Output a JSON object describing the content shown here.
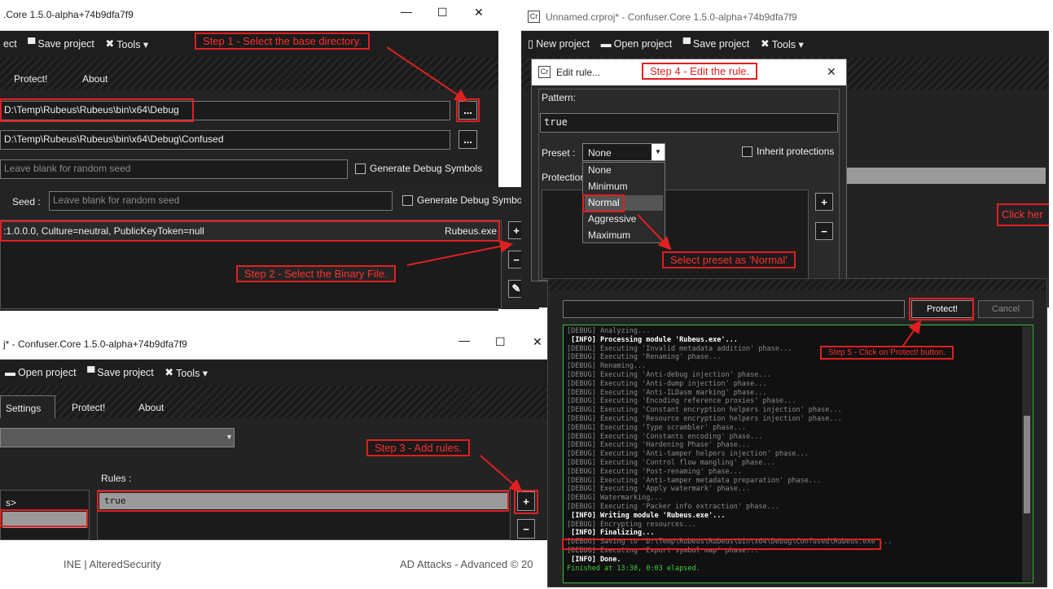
{
  "win1": {
    "title": ".Core 1.5.0-alpha+74b9dfa7f9",
    "menu": {
      "project": "ect",
      "save": "Save project",
      "tools": "Tools ▾"
    },
    "tabs": [
      "Protect!",
      "About"
    ],
    "base_dir": "D:\\Temp\\Rubeus\\Rubeus\\bin\\x64\\Debug",
    "output_dir": "D:\\Temp\\Rubeus\\Rubeus\\bin\\x64\\Debug\\Confused",
    "seed_placeholder": "Leave blank for random seed",
    "gen_debug": "Generate Debug Symbols",
    "seed_label": "Seed :",
    "seed_placeholder2": "Leave blank for random seed",
    "gen_debug2": "Generate Debug Symbo",
    "module_info": ":1.0.0.0, Culture=neutral, PublicKeyToken=null",
    "module_name": "Rubeus.exe",
    "browse": "...",
    "plus": "+",
    "minus": "−"
  },
  "win2": {
    "title": "Unnamed.crproj* - Confuser.Core 1.5.0-alpha+74b9dfa7f9",
    "app_icon": "Cr",
    "menu": {
      "new": "New project",
      "open": "Open project",
      "save": "Save project",
      "tools": "Tools ▾"
    },
    "click_here": "Click her",
    "dialog": {
      "title": "Edit rule...",
      "icon": "Cr",
      "close": "✕",
      "pattern_label": "Pattern:",
      "pattern_value": "true",
      "preset_label": "Preset :",
      "preset_value": "None",
      "inherit": "Inherit protections",
      "protections_label": "Protection",
      "options": [
        "None",
        "Minimum",
        "Normal",
        "Aggressive",
        "Maximum"
      ],
      "plus": "+",
      "minus": "−"
    }
  },
  "win3": {
    "title": "j* - Confuser.Core 1.5.0-alpha+74b9dfa7f9",
    "menu": {
      "open": "Open project",
      "save": "Save project",
      "tools": "Tools ▾"
    },
    "tabs": [
      "Settings",
      "Protect!",
      "About"
    ],
    "rules_label": "Rules :",
    "rule_value": "true",
    "module_item": "s>",
    "plus": "+",
    "minus": "−"
  },
  "win4": {
    "protect": "Protect!",
    "cancel": "Cancel",
    "log": [
      {
        "t": "dbg",
        "s": "[DEBUG] Analyzing..."
      },
      {
        "t": "info",
        "s": " [INFO] Processing module 'Rubeus.exe'..."
      },
      {
        "t": "dbg",
        "s": "[DEBUG] Executing 'Invalid metadata addition' phase..."
      },
      {
        "t": "dbg",
        "s": "[DEBUG] Executing 'Renaming' phase..."
      },
      {
        "t": "dbg",
        "s": "[DEBUG] Renaming..."
      },
      {
        "t": "dbg",
        "s": "[DEBUG] Executing 'Anti-debug injection' phase..."
      },
      {
        "t": "dbg",
        "s": "[DEBUG] Executing 'Anti-dump injection' phase..."
      },
      {
        "t": "dbg",
        "s": "[DEBUG] Executing 'Anti-ILDasm marking' phase..."
      },
      {
        "t": "dbg",
        "s": "[DEBUG] Executing 'Encoding reference proxies' phase..."
      },
      {
        "t": "dbg",
        "s": "[DEBUG] Executing 'Constant encryption helpers injection' phase..."
      },
      {
        "t": "dbg",
        "s": "[DEBUG] Executing 'Resource encryption helpers injection' phase..."
      },
      {
        "t": "dbg",
        "s": "[DEBUG] Executing 'Type scrambler' phase..."
      },
      {
        "t": "dbg",
        "s": "[DEBUG] Executing 'Constants encoding' phase..."
      },
      {
        "t": "dbg",
        "s": "[DEBUG] Executing 'Hardening Phase' phase..."
      },
      {
        "t": "dbg",
        "s": "[DEBUG] Executing 'Anti-tamper helpers injection' phase..."
      },
      {
        "t": "dbg",
        "s": "[DEBUG] Executing 'Control flow mangling' phase..."
      },
      {
        "t": "dbg",
        "s": "[DEBUG] Executing 'Post-renaming' phase..."
      },
      {
        "t": "dbg",
        "s": "[DEBUG] Executing 'Anti-tamper metadata preparation' phase..."
      },
      {
        "t": "dbg",
        "s": "[DEBUG] Executing 'Apply watermark' phase..."
      },
      {
        "t": "dbg",
        "s": "[DEBUG] Watermarking..."
      },
      {
        "t": "dbg",
        "s": "[DEBUG] Executing 'Packer info extraction' phase..."
      },
      {
        "t": "info",
        "s": " [INFO] Writing module 'Rubeus.exe'..."
      },
      {
        "t": "dbg",
        "s": "[DEBUG] Encrypting resources..."
      },
      {
        "t": "info",
        "s": " [INFO] Finalizing..."
      },
      {
        "t": "dbg",
        "s": "[DEBUG] Saving to 'D:\\Temp\\Rubeus\\Rubeus\\bin\\x64\\Debug\\Confused\\Rubeus.exe'..."
      },
      {
        "t": "dbg",
        "s": "[DEBUG] Executing 'Export symbol map' phase..."
      },
      {
        "t": "info",
        "s": " [INFO] Done."
      },
      {
        "t": "fin",
        "s": "Finished at 13:30, 0:03 elapsed."
      }
    ]
  },
  "annotations": {
    "step1": "Step 1 - Select the base directory.",
    "step2": "Step 2 - Select the Binary File.",
    "step3": "Step 3 - Add rules.",
    "step4": "Step 4 - Edit the rule.",
    "preset": "Select preset as 'Normal'",
    "step5": "Step 5 - Click on Protect! button."
  },
  "footer": {
    "left": "INE | AlteredSecurity",
    "right": "AD Attacks - Advanced © 20"
  },
  "colors": {
    "annotation_red": "#e02020",
    "log_border": "#3fbf3f",
    "dark_bg": "#1f1f1f"
  }
}
